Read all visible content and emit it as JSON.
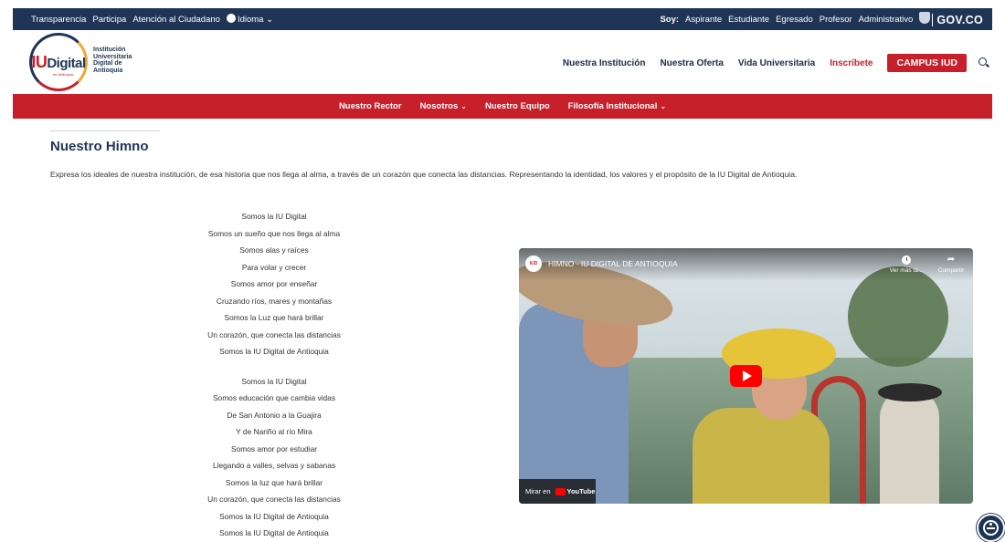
{
  "gov_bar": {
    "links": [
      "Transparencia",
      "Participa",
      "Atención al Ciudadano"
    ],
    "language": "Idioma",
    "soy_label": "Soy:",
    "profiles": [
      "Aspirante",
      "Estudiante",
      "Egresado",
      "Profesor",
      "Administrativo"
    ],
    "govco": "GOV.CO"
  },
  "header": {
    "logo_mark_iu": "IU",
    "logo_mark_digital": "Digital",
    "logo_sub": "de Antioquia",
    "logo_text": [
      "Institución",
      "Universitaria",
      "Digital de",
      "Antioquia"
    ],
    "nav": [
      "Nuestra Institución",
      "Nuestra Oferta",
      "Vida Universitaria"
    ],
    "inscribete": "Inscríbete",
    "campus": "CAMPUS IUD"
  },
  "subnav": {
    "items": [
      "Nuestro Rector",
      "Nosotros",
      "Nuestro Equipo",
      "Filosofía Institucional"
    ]
  },
  "main": {
    "title": "Nuestro Himno",
    "intro": "Expresa los ideales de nuestra institución, de esa historia que nos llega al alma, a través de un corazón que conecta las distancias. Representando la identidad, los valores y el propósito de la IU Digital de Antioquia.",
    "stanza1": [
      "Somos la IU Digital",
      "Somos un sueño que nos llega al alma",
      "Somos alas y raíces",
      "Para volar y crecer",
      "Somos amor por enseñar",
      "Cruzando ríos, mares y montañas",
      "Somos la Luz que hará brillar",
      "Un corazón, que conecta las distancias",
      "Somos la IU Digital de Antioquia"
    ],
    "stanza2": [
      "Somos la IU Digital",
      "Somos educación que cambia vidas",
      "De San Antonio a la Guajira",
      "Y de Nariño al río Mira",
      "Somos amor por estudiar",
      "Llegando a valles, selvas y sabanas",
      "Somos la luz que hará brillar",
      "Un corazón, que conecta las distancias",
      "Somos la IU Digital de Antioquia",
      "Somos la IU Digital de Antioquia"
    ]
  },
  "video": {
    "channel_badge": "IUD",
    "title": "HIMNO - IU DIGITAL DE ANTIOQUIA",
    "watch_later": "Ver más ta...",
    "share": "Compartir",
    "watch_on": "Mirar en",
    "youtube": "YouTube"
  },
  "colors": {
    "navy": "#1f3556",
    "red": "#c8202b"
  }
}
